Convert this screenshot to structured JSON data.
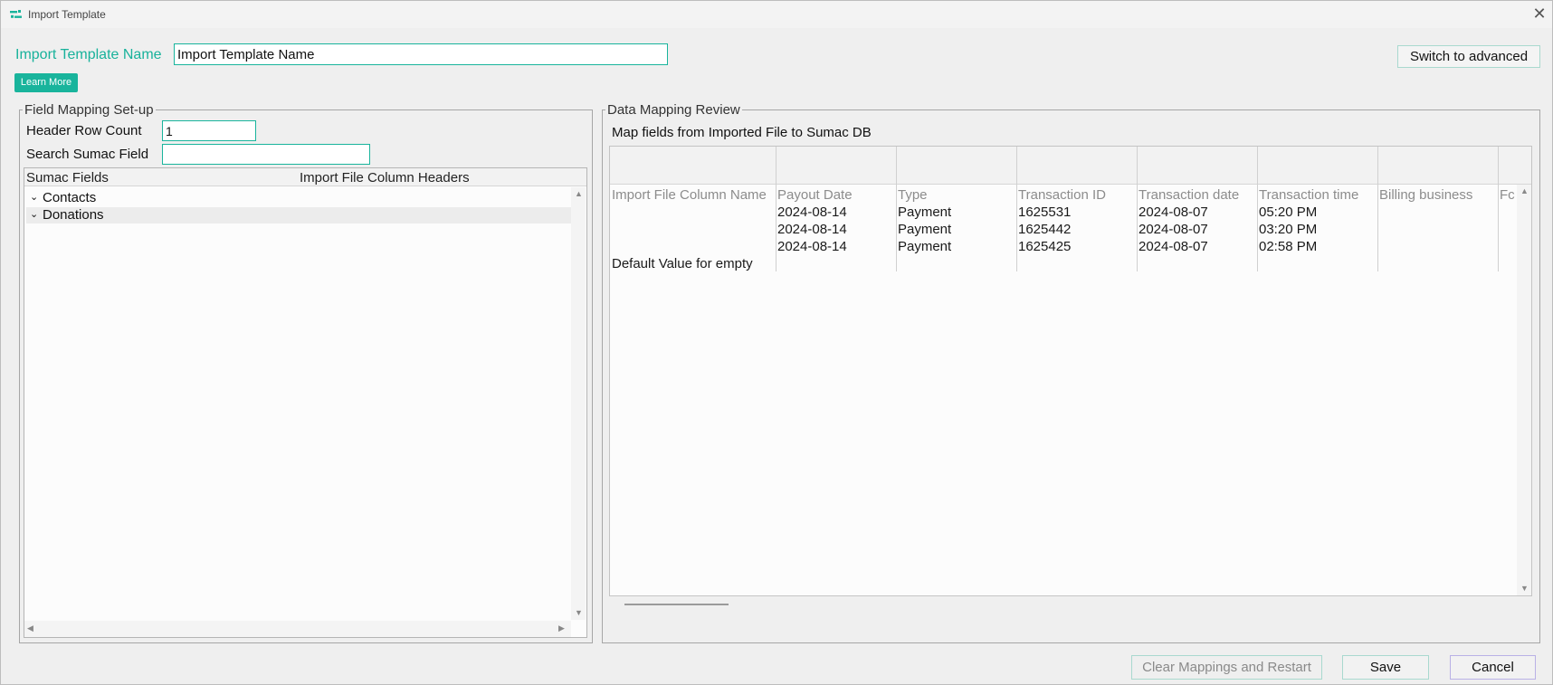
{
  "window": {
    "title": "Import Template"
  },
  "template_name": {
    "label": "Import Template Name",
    "value": "Import Template Name"
  },
  "learn_more": "Learn More",
  "switch_advanced": "Switch to advanced",
  "field_mapping": {
    "legend": "Field Mapping Set-up",
    "header_row_label": "Header Row Count",
    "header_row_value": "1",
    "search_label": "Search Sumac Field",
    "search_value": "",
    "col_sumac": "Sumac Fields",
    "col_import": "Import File Column Headers",
    "items": [
      {
        "label": "Contacts"
      },
      {
        "label": "Donations"
      }
    ]
  },
  "data_review": {
    "legend": "Data Mapping Review",
    "subtitle": "Map fields from Imported File to Sumac DB",
    "row_label_header": "Import File Column Name",
    "row_label_default": "Default Value for empty",
    "columns": [
      "Payout Date",
      "Type",
      "Transaction ID",
      "Transaction date",
      "Transaction time",
      "Billing business",
      "Fc"
    ],
    "rows": [
      [
        "2024-08-14",
        "Payment",
        "1625531",
        "2024-08-07",
        "05:20 PM",
        "",
        ""
      ],
      [
        "2024-08-14",
        "Payment",
        "1625442",
        "2024-08-07",
        "03:20 PM",
        "",
        ""
      ],
      [
        "2024-08-14",
        "Payment",
        "1625425",
        "2024-08-07",
        "02:58 PM",
        "",
        ""
      ]
    ]
  },
  "buttons": {
    "clear": "Clear Mappings and Restart",
    "save": "Save",
    "cancel": "Cancel"
  }
}
